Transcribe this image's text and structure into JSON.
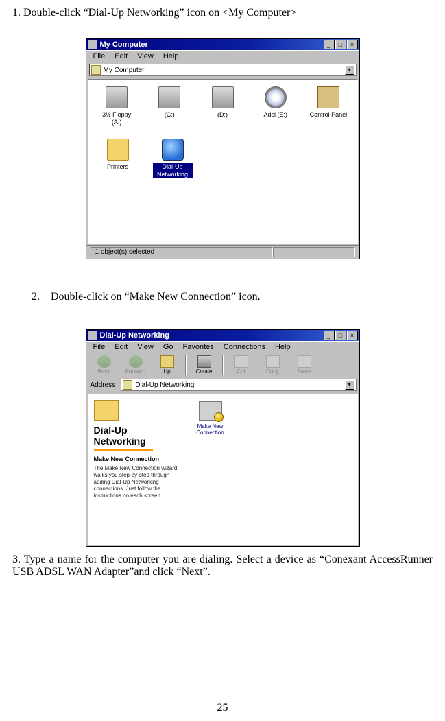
{
  "steps": {
    "s1": "1. Double-click “Dial-Up Networking” icon on <My Computer>",
    "s2_num": "2.",
    "s2_txt": "Double-click on “Make New Connection” icon.",
    "s3": "3. Type a name for the computer you are dialing. Select a device  as “Conexant AccessRunner USB ADSL WAN Adapter”and click “Next”."
  },
  "mycomp": {
    "title": "My Computer",
    "menus": {
      "file": "File",
      "edit": "Edit",
      "view": "View",
      "help": "Help"
    },
    "addr_text": "My Computer",
    "icons": {
      "floppy": "3½ Floppy (A:)",
      "c": "(C:)",
      "d": "(D:)",
      "adsl": "Adsl (E:)",
      "ctrl": "Control Panel",
      "printers": "Printers",
      "dun": "Dial-Up Networking"
    },
    "status": "1 object(s) selected"
  },
  "dun": {
    "title": "Dial-Up Networking",
    "menus": {
      "file": "File",
      "edit": "Edit",
      "view": "View",
      "go": "Go",
      "fav": "Favorites",
      "conn": "Connections",
      "help": "Help"
    },
    "tools": {
      "back": "Back",
      "fwd": "Forward",
      "up": "Up",
      "create": "Create",
      "cut": "Cut",
      "copy": "Copy",
      "paste": "Paste"
    },
    "addr_label": "Address",
    "addr_text": "Dial-Up Networking",
    "left": {
      "heading": "Dial-Up Networking",
      "sub": "Make New Connection",
      "desc": "The Make New Connection wizard walks you step-by-step through adding Dial-Up Networking connections. Just follow the instructions on each screen."
    },
    "mk_label": "Make New Connection"
  },
  "winbtn": {
    "min": "_",
    "max": "□",
    "close": "×"
  },
  "dropdown_glyph": "▾",
  "page_number": "25"
}
